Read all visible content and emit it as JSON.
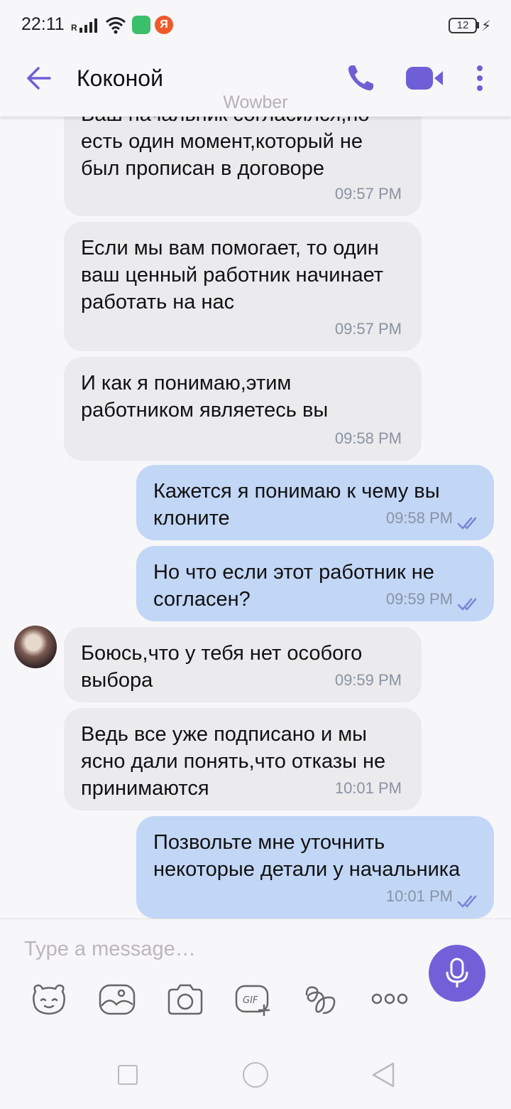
{
  "status_bar": {
    "time": "22:11",
    "network_label": "R",
    "yandex_badge": "Я",
    "battery": "12"
  },
  "header": {
    "title": "Коконой",
    "watermark": "Wowber",
    "accent_color": "#6f5fd6"
  },
  "messages": [
    {
      "direction": "in",
      "text": "Ваш начальник согласился,но есть один момент,который не был прописан в договоре",
      "time": "09:57 PM"
    },
    {
      "direction": "in",
      "text": "Если мы вам помогает, то один ваш ценный работник начинает работать на нас",
      "time": "09:57 PM"
    },
    {
      "direction": "in",
      "text": "И как я понимаю,этим работником являетесь вы",
      "time": "09:58 PM"
    },
    {
      "direction": "out",
      "text": "Кажется я понимаю к чему вы клоните",
      "time": "09:58 PM",
      "status": "read"
    },
    {
      "direction": "out",
      "text": "Но что если этот работник не согласен?",
      "time": "09:59 PM",
      "status": "read"
    },
    {
      "direction": "in",
      "text": "Боюсь,что у тебя нет особого выбора",
      "time": "09:59 PM"
    },
    {
      "direction": "in",
      "text": "Ведь все уже подписано и мы ясно дали понять,что отказы не принимаются",
      "time": "10:01 PM"
    },
    {
      "direction": "out",
      "text": "Позвольте мне уточнить некоторые детали у начальника",
      "time": "10:01 PM",
      "status": "read"
    }
  ],
  "composer": {
    "placeholder": "Type a message…",
    "value": "",
    "tools": [
      "sticker-icon",
      "gallery-icon",
      "camera-icon",
      "gif-icon",
      "doodle-icon",
      "more-options-icon"
    ],
    "gif_label": "GIF"
  },
  "colors": {
    "incoming_bubble": "#ebeaec",
    "outgoing_bubble": "#c2d6f6",
    "mic_button": "#7360d8"
  }
}
